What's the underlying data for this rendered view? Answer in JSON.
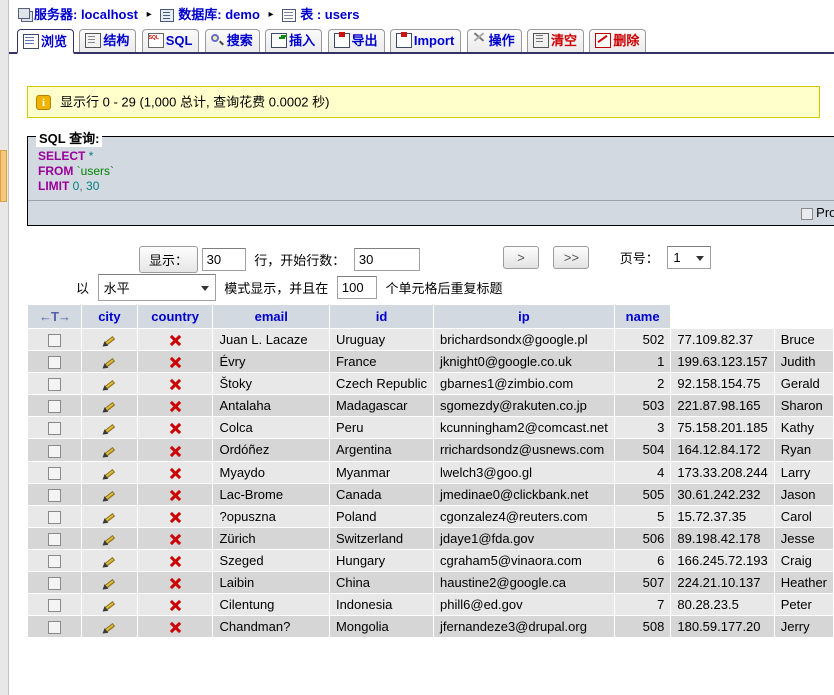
{
  "breadcrumb": {
    "server_label": "服务器: localhost",
    "database_label": "数据库: demo",
    "table_label": "表 : users",
    "separator": "▸"
  },
  "tabs": [
    {
      "label": "浏览",
      "icon": "browse-icon",
      "active": true,
      "danger": false
    },
    {
      "label": "结构",
      "icon": "structure-icon",
      "active": false,
      "danger": false
    },
    {
      "label": "SQL",
      "icon": "sql-icon",
      "active": false,
      "danger": false
    },
    {
      "label": "搜索",
      "icon": "search-icon",
      "active": false,
      "danger": false
    },
    {
      "label": "插入",
      "icon": "insert-icon",
      "active": false,
      "danger": false
    },
    {
      "label": "导出",
      "icon": "export-icon",
      "active": false,
      "danger": false
    },
    {
      "label": "Import",
      "icon": "import-icon",
      "active": false,
      "danger": false
    },
    {
      "label": "操作",
      "icon": "operations-icon",
      "active": false,
      "danger": false
    },
    {
      "label": "清空",
      "icon": "empty-icon",
      "active": false,
      "danger": true
    },
    {
      "label": "删除",
      "icon": "drop-icon",
      "active": false,
      "danger": true
    }
  ],
  "info": {
    "icon_char": "i",
    "text": "显示行 0 - 29 (1,000 总计, 查询花费 0.0002 秒)"
  },
  "sql": {
    "legend": "SQL 查询:",
    "line1_kw": "SELECT",
    "line1_star": "*",
    "line2_kw": "FROM",
    "line2_tbl": "`users`",
    "line3_kw": "LIMIT",
    "line3_a": "0",
    "line3_comma": ",",
    "line3_b": "30",
    "profiling_label": "Prof"
  },
  "controls": {
    "show_button": "显示：",
    "rows_value": "30",
    "rows_label": "行，开始行数：",
    "start_value": "30",
    "prefix_label": "以",
    "mode_value": "水平",
    "mode_label": "模式显示，并且在",
    "repeat_value": "100",
    "repeat_label": "个单元格后重复标题",
    "next_label": ">",
    "last_label": ">>",
    "page_label": "页号：",
    "page_value": "1"
  },
  "table": {
    "sort_arrows": "←T→",
    "columns": [
      "city",
      "country",
      "email",
      "id",
      "ip",
      "name"
    ],
    "rows": [
      {
        "city": "Juan L. Lacaze",
        "country": "Uruguay",
        "email": "brichardsondx@google.pl",
        "id": "502",
        "ip": "77.109.82.37",
        "name": "Bruce"
      },
      {
        "city": "Évry",
        "country": "France",
        "email": "jknight0@google.co.uk",
        "id": "1",
        "ip": "199.63.123.157",
        "name": "Judith"
      },
      {
        "city": "Štoky",
        "country": "Czech Republic",
        "email": "gbarnes1@zimbio.com",
        "id": "2",
        "ip": "92.158.154.75",
        "name": "Gerald"
      },
      {
        "city": "Antalaha",
        "country": "Madagascar",
        "email": "sgomezdy@rakuten.co.jp",
        "id": "503",
        "ip": "221.87.98.165",
        "name": "Sharon"
      },
      {
        "city": "Colca",
        "country": "Peru",
        "email": "kcunningham2@comcast.net",
        "id": "3",
        "ip": "75.158.201.185",
        "name": "Kathy"
      },
      {
        "city": "Ordóñez",
        "country": "Argentina",
        "email": "rrichardsondz@usnews.com",
        "id": "504",
        "ip": "164.12.84.172",
        "name": "Ryan"
      },
      {
        "city": "Myaydo",
        "country": "Myanmar",
        "email": "lwelch3@goo.gl",
        "id": "4",
        "ip": "173.33.208.244",
        "name": "Larry"
      },
      {
        "city": "Lac-Brome",
        "country": "Canada",
        "email": "jmedinae0@clickbank.net",
        "id": "505",
        "ip": "30.61.242.232",
        "name": "Jason"
      },
      {
        "city": "?opuszna",
        "country": "Poland",
        "email": "cgonzalez4@reuters.com",
        "id": "5",
        "ip": "15.72.37.35",
        "name": "Carol"
      },
      {
        "city": "Zürich",
        "country": "Switzerland",
        "email": "jdaye1@fda.gov",
        "id": "506",
        "ip": "89.198.42.178",
        "name": "Jesse"
      },
      {
        "city": "Szeged",
        "country": "Hungary",
        "email": "cgraham5@vinaora.com",
        "id": "6",
        "ip": "166.245.72.193",
        "name": "Craig"
      },
      {
        "city": "Laibin",
        "country": "China",
        "email": "haustine2@google.ca",
        "id": "507",
        "ip": "224.21.10.137",
        "name": "Heather"
      },
      {
        "city": "Cilentung",
        "country": "Indonesia",
        "email": "phill6@ed.gov",
        "id": "7",
        "ip": "80.28.23.5",
        "name": "Peter"
      },
      {
        "city": "Chandman?",
        "country": "Mongolia",
        "email": "jfernandeze3@drupal.org",
        "id": "508",
        "ip": "180.59.177.20",
        "name": "Jerry"
      }
    ]
  },
  "colors": {
    "link_blue": "#0000cc",
    "danger_red": "#cc0000",
    "info_bg": "#ffffcc",
    "info_border": "#cccc00",
    "header_bg": "#d3d9e0",
    "row_odd": "#e8e8e8",
    "row_even": "#d6d6d6"
  }
}
